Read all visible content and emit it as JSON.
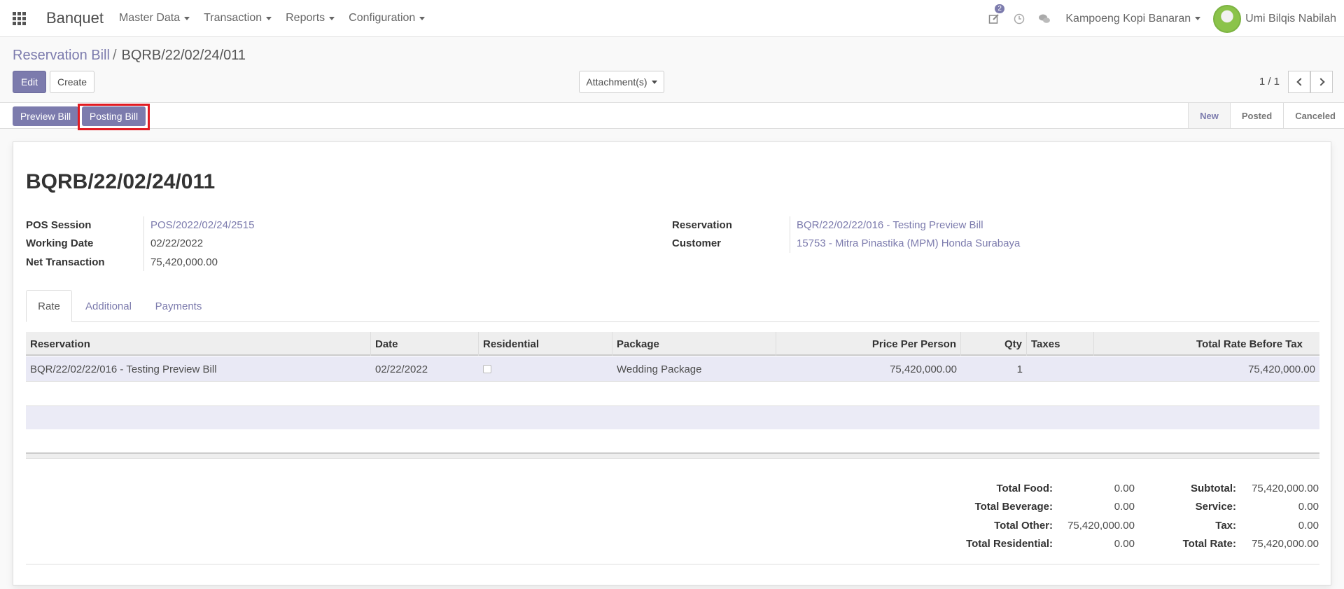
{
  "navbar": {
    "brand": "Banquet",
    "menus": [
      "Master Data",
      "Transaction",
      "Reports",
      "Configuration"
    ],
    "activity_badge": "2",
    "company": "Kampoeng Kopi Banaran",
    "user": "Umi Bilqis Nabilah"
  },
  "breadcrumb": {
    "parent": "Reservation Bill",
    "separator": "/",
    "current": "BQRB/22/02/24/011"
  },
  "buttons": {
    "edit": "Edit",
    "create": "Create",
    "attachments": "Attachment(s)",
    "preview_bill": "Preview Bill",
    "posting_bill": "Posting Bill"
  },
  "pager": {
    "value": "1 / 1"
  },
  "stages": [
    {
      "label": "New",
      "active": true
    },
    {
      "label": "Posted",
      "active": false
    },
    {
      "label": "Canceled",
      "active": false
    }
  ],
  "record": {
    "title": "BQRB/22/02/24/011",
    "fields_left": [
      {
        "label": "POS Session",
        "value": "POS/2022/02/24/2515",
        "link": true
      },
      {
        "label": "Working Date",
        "value": "02/22/2022",
        "link": false
      },
      {
        "label": "Net Transaction",
        "value": "75,420,000.00",
        "link": false
      }
    ],
    "fields_right": [
      {
        "label": "Reservation",
        "value": "BQR/22/02/22/016 - Testing Preview Bill",
        "link": true
      },
      {
        "label": "Customer",
        "value": "15753 - Mitra Pinastika (MPM) Honda Surabaya",
        "link": true
      }
    ]
  },
  "tabs": [
    {
      "label": "Rate",
      "active": true
    },
    {
      "label": "Additional",
      "active": false
    },
    {
      "label": "Payments",
      "active": false
    }
  ],
  "table": {
    "columns": [
      "Reservation",
      "Date",
      "Residential",
      "Package",
      "Price Per Person",
      "Qty",
      "Taxes",
      "Total Rate Before Tax"
    ],
    "rows": [
      {
        "reservation": "BQR/22/02/22/016 - Testing Preview Bill",
        "date": "02/22/2022",
        "residential": false,
        "package": "Wedding Package",
        "price_per_person": "75,420,000.00",
        "qty": "1",
        "taxes": "",
        "total": "75,420,000.00"
      }
    ]
  },
  "totals_left": [
    {
      "label": "Total Food:",
      "value": "0.00"
    },
    {
      "label": "Total Beverage:",
      "value": "0.00"
    },
    {
      "label": "Total Other:",
      "value": "75,420,000.00"
    },
    {
      "label": "Total Residential:",
      "value": "0.00"
    }
  ],
  "totals_right": [
    {
      "label": "Subtotal:",
      "value": "75,420,000.00"
    },
    {
      "label": "Service:",
      "value": "0.00"
    },
    {
      "label": "Tax:",
      "value": "0.00"
    },
    {
      "label": "Total Rate:",
      "value": "75,420,000.00"
    }
  ],
  "colors": {
    "primary": "#7c7bad",
    "highlight": "#e11b22"
  }
}
